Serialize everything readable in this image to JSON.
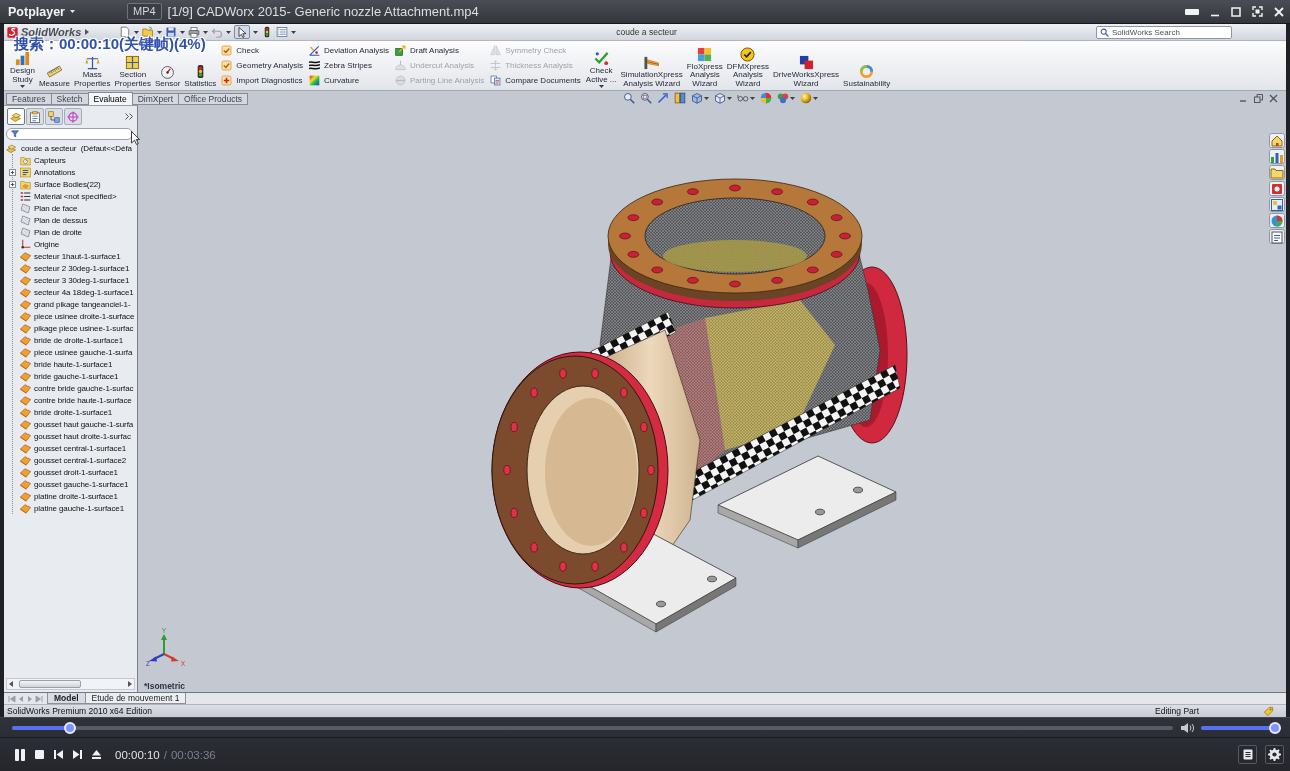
{
  "player": {
    "menu": "Potplayer",
    "format": "MP4",
    "title": "[1/9] CADWorx 2015- Generic nozzle Attachment.mp4",
    "osd": "搜索：00:00:10(关键帧)(4%)"
  },
  "cad_window": {
    "logo": "SolidWorks",
    "document": "coude a secteur",
    "search": {
      "placeholder": "SolidWorks Search"
    }
  },
  "ribbon": [
    {
      "kind": "large",
      "label": [
        "Design",
        "Study"
      ],
      "dropdown": true
    },
    {
      "kind": "large",
      "label": [
        "Measure"
      ],
      "dropdown": false
    },
    {
      "kind": "large",
      "label": [
        "Mass",
        "Properties"
      ],
      "dropdown": false
    },
    {
      "kind": "large",
      "label": [
        "Section",
        "Properties"
      ],
      "dropdown": false
    },
    {
      "kind": "large",
      "label": [
        "Sensor"
      ],
      "dropdown": false
    },
    {
      "kind": "large",
      "label": [
        "Statistics"
      ],
      "dropdown": false
    },
    {
      "kind": "stack",
      "items": [
        {
          "label": "Check",
          "disabled": false
        },
        {
          "label": "Geometry Analysis",
          "disabled": false
        },
        {
          "label": "Import Diagnostics",
          "disabled": false
        }
      ]
    },
    {
      "kind": "stack",
      "items": [
        {
          "label": "Deviation Analysis",
          "disabled": false
        },
        {
          "label": "Zebra Stripes",
          "disabled": false
        },
        {
          "label": "Curvature",
          "disabled": false
        }
      ]
    },
    {
      "kind": "stack",
      "items": [
        {
          "label": "Draft Analysis",
          "disabled": false
        },
        {
          "label": "Undercut Analysis",
          "disabled": true
        },
        {
          "label": "Parting Line Analysis",
          "disabled": true
        }
      ]
    },
    {
      "kind": "stack",
      "items": [
        {
          "label": "Symmetry Check",
          "disabled": true
        },
        {
          "label": "Thickness Analysis",
          "disabled": true
        },
        {
          "label": "Compare Documents",
          "disabled": false
        }
      ]
    },
    {
      "kind": "large",
      "label": [
        "Check",
        "Active ..."
      ],
      "dropdown": true
    },
    {
      "kind": "large",
      "label": [
        "SimulationXpress",
        "Analysis Wizard"
      ],
      "dropdown": false
    },
    {
      "kind": "large",
      "label": [
        "FloXpress",
        "Analysis",
        "Wizard"
      ],
      "dropdown": false
    },
    {
      "kind": "large",
      "label": [
        "DFMXpress",
        "Analysis",
        "Wizard"
      ],
      "dropdown": false
    },
    {
      "kind": "large",
      "label": [
        "DriveWorksXpress",
        "Wizard"
      ],
      "dropdown": false
    },
    {
      "kind": "large",
      "label": [
        "Sustainability"
      ],
      "dropdown": false
    }
  ],
  "command_tabs": [
    {
      "label": "Features",
      "selected": false
    },
    {
      "label": "Sketch",
      "selected": false
    },
    {
      "label": "Evaluate",
      "selected": true
    },
    {
      "label": "DimXpert",
      "selected": false
    },
    {
      "label": "Office Products",
      "selected": false
    }
  ],
  "manager_tabs": [
    {
      "selected": true
    },
    {
      "selected": false
    },
    {
      "selected": false
    },
    {
      "selected": false
    }
  ],
  "feature_tree": {
    "label": "coude a secteur  (Défaut<<Défa",
    "kind": "part",
    "children": [
      {
        "label": "Capteurs",
        "kind": "sensors"
      },
      {
        "label": "Annotations",
        "kind": "annotations",
        "expanded": false
      },
      {
        "label": "Surface Bodies(22)",
        "kind": "bodies",
        "expanded": false
      },
      {
        "label": "Material <not specified>",
        "kind": "material"
      },
      {
        "label": "Plan de face",
        "kind": "plane"
      },
      {
        "label": "Plan de dessus",
        "kind": "plane"
      },
      {
        "label": "Plan de droite",
        "kind": "plane"
      },
      {
        "label": "Origine",
        "kind": "origin"
      },
      {
        "label": "secteur 1haut-1-surface1",
        "kind": "surface"
      },
      {
        "label": "secteur 2 30deg-1-surface1",
        "kind": "surface"
      },
      {
        "label": "secteur 3 30deg-1-surface1",
        "kind": "surface"
      },
      {
        "label": "secteur 4a 18deg-1-surface1",
        "kind": "surface"
      },
      {
        "label": "grand pikage tangeanciel-1-",
        "kind": "surface"
      },
      {
        "label": "piece usinee droite-1-surface",
        "kind": "surface"
      },
      {
        "label": "pikage piece usinee-1-surfac",
        "kind": "surface"
      },
      {
        "label": "bride de droite-1-surface1",
        "kind": "surface"
      },
      {
        "label": "piece usinee gauche-1-surfa",
        "kind": "surface"
      },
      {
        "label": "bride haute-1-surface1",
        "kind": "surface"
      },
      {
        "label": "bride gauche-1-surface1",
        "kind": "surface"
      },
      {
        "label": "contre bride gauche-1-surfac",
        "kind": "surface"
      },
      {
        "label": "contre bride haute-1-surface",
        "kind": "surface"
      },
      {
        "label": "bride droite-1-surface1",
        "kind": "surface"
      },
      {
        "label": "gousset haut gauche-1-surfa",
        "kind": "surface"
      },
      {
        "label": "gousset haut droite-1-surfac",
        "kind": "surface"
      },
      {
        "label": "gousset central-1-surface1",
        "kind": "surface"
      },
      {
        "label": "gousset central-1-surface2",
        "kind": "surface"
      },
      {
        "label": "gousset droit-1-surface1",
        "kind": "surface"
      },
      {
        "label": "gousset gauche-1-surface1",
        "kind": "surface"
      },
      {
        "label": "platine droite-1-surface1",
        "kind": "surface"
      },
      {
        "label": "platine gauche-1-surface1",
        "kind": "surface"
      }
    ]
  },
  "viewport": {
    "view_name": "*Isometric",
    "triad": {
      "x": "X",
      "y": "Y",
      "z": "Z"
    }
  },
  "bottom_tabs": [
    {
      "label": "Model",
      "selected": true
    },
    {
      "label": "Etude de mouvement 1",
      "selected": false
    }
  ],
  "status_bar": {
    "edition": "SolidWorks Premium 2010 x64 Edition",
    "mode": "Editing Part"
  },
  "playback": {
    "playing": true,
    "seek": {
      "level": 0.05
    },
    "elapsed": "00:00:10",
    "separator": "/",
    "duration": "00:03:36",
    "volume": {
      "level": 0.92
    }
  }
}
